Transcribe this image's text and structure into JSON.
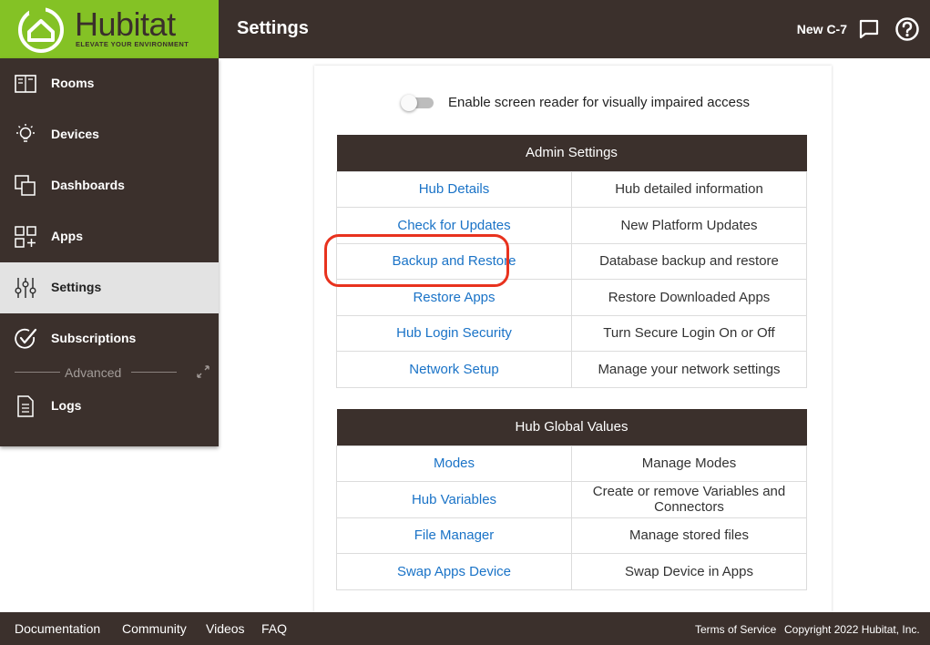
{
  "brand": {
    "name": "Hubitat",
    "tagline": "ELEVATE YOUR ENVIRONMENT",
    "color": "#84c225"
  },
  "header": {
    "title": "Settings",
    "hub_name": "New C-7",
    "icons": [
      "chat-icon",
      "help-icon"
    ]
  },
  "sidebar": {
    "items": [
      {
        "label": "Rooms",
        "icon": "rooms-icon"
      },
      {
        "label": "Devices",
        "icon": "bulb-icon"
      },
      {
        "label": "Dashboards",
        "icon": "dashboards-icon"
      },
      {
        "label": "Apps",
        "icon": "apps-icon"
      },
      {
        "label": "Settings",
        "icon": "sliders-icon",
        "active": true
      },
      {
        "label": "Subscriptions",
        "icon": "check-circle-icon"
      },
      {
        "label": "Logs",
        "icon": "document-icon"
      }
    ],
    "advanced_label": "Advanced"
  },
  "main": {
    "screen_reader_label": "Enable screen reader for visually impaired access",
    "screen_reader_enabled": false,
    "admin": {
      "title": "Admin Settings",
      "rows": [
        {
          "link": "Hub Details",
          "desc": "Hub detailed information"
        },
        {
          "link": "Check for Updates",
          "desc": "New Platform Updates"
        },
        {
          "link": "Backup and Restore",
          "desc": "Database backup and restore"
        },
        {
          "link": "Restore Apps",
          "desc": "Restore Downloaded Apps"
        },
        {
          "link": "Hub Login Security",
          "desc": "Turn Secure Login On or Off"
        },
        {
          "link": "Network Setup",
          "desc": "Manage your network settings"
        }
      ]
    },
    "global": {
      "title": "Hub Global Values",
      "rows": [
        {
          "link": "Modes",
          "desc": "Manage Modes"
        },
        {
          "link": "Hub Variables",
          "desc": "Create or remove Variables and Connectors"
        },
        {
          "link": "File Manager",
          "desc": "Manage stored files"
        },
        {
          "link": "Swap Apps Device",
          "desc": "Swap Device in Apps"
        }
      ]
    }
  },
  "footer": {
    "links": [
      "Documentation",
      "Community",
      "Videos",
      "FAQ"
    ],
    "terms": "Terms of Service",
    "copyright": "Copyright 2022 Hubitat, Inc."
  },
  "colors": {
    "header_bg": "#3b302c",
    "link": "#1a73c7",
    "highlight": "#e8321e",
    "active_bg": "#e3e3e3"
  }
}
